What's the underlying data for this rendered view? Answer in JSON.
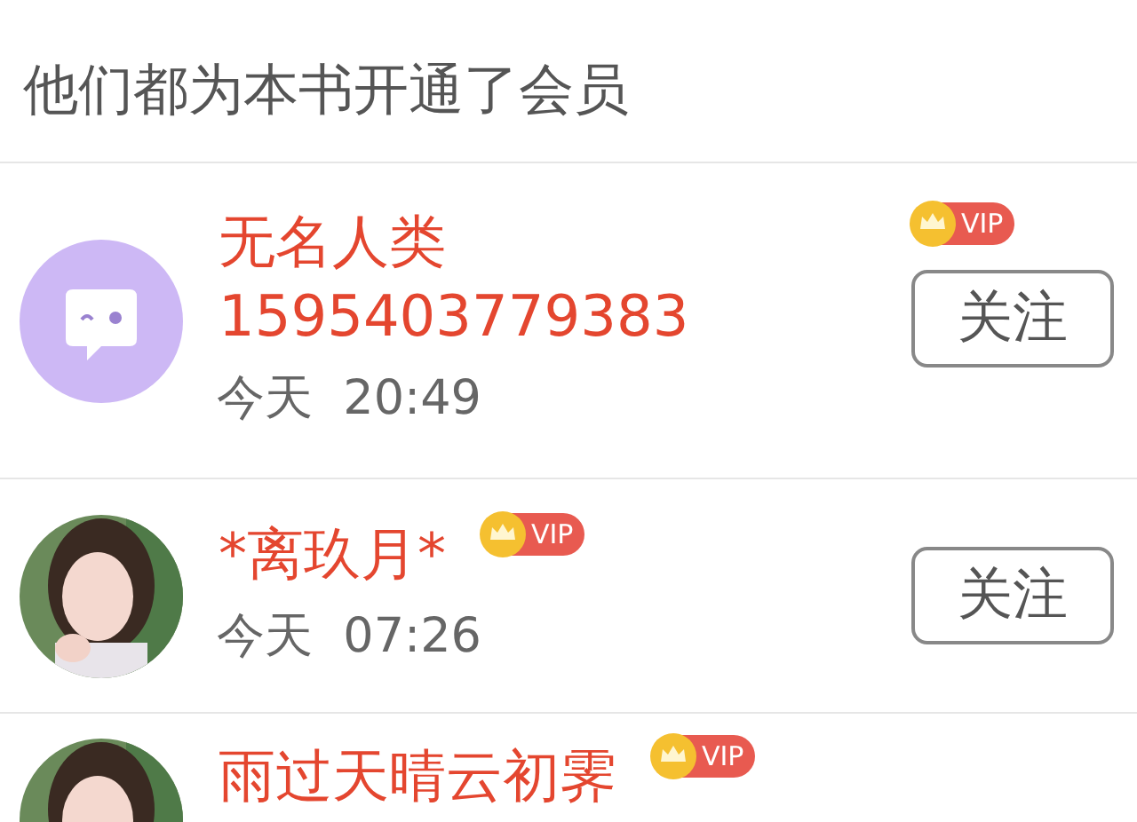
{
  "header": {
    "title": "他们都为本书开通了会员"
  },
  "members": [
    {
      "avatar": {
        "kind": "icon"
      },
      "name_lines": [
        "无名人类",
        "1595403779383"
      ],
      "vip": {
        "label": "VIP",
        "kind": "corner"
      },
      "time": "今天  20:49",
      "follow_button": "关注"
    },
    {
      "avatar": {
        "kind": "picture"
      },
      "name_lines": [
        "*离玖月*"
      ],
      "vip": {
        "label": "VIP",
        "kind": "inline"
      },
      "time": "今天  07:26",
      "follow_button": "关注"
    },
    {
      "avatar": {
        "kind": "picture"
      },
      "name_lines": [
        "雨过天晴云初霁"
      ],
      "vip": {
        "label": "VIP",
        "kind": "inline"
      }
    }
  ]
}
